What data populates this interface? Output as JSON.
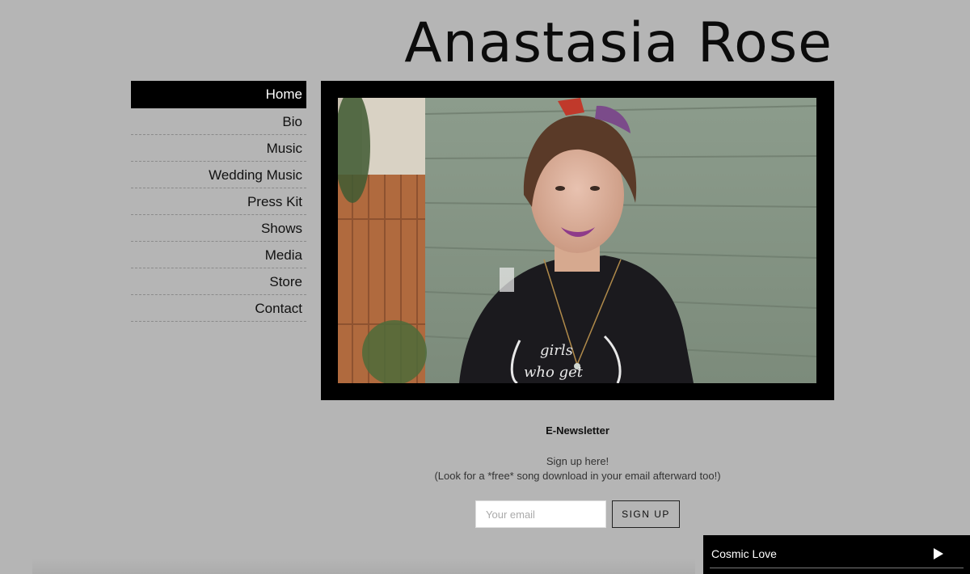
{
  "site": {
    "title": "Anastasia Rose"
  },
  "nav": {
    "items": [
      {
        "label": "Home",
        "active": true
      },
      {
        "label": "Bio"
      },
      {
        "label": "Music"
      },
      {
        "label": "Wedding Music"
      },
      {
        "label": "Press Kit"
      },
      {
        "label": "Shows"
      },
      {
        "label": "Media"
      },
      {
        "label": "Store"
      },
      {
        "label": "Contact"
      }
    ]
  },
  "newsletter": {
    "title": "E-Newsletter",
    "line1": "Sign up here!",
    "line2": "(Look for a *free* song download in your email afterward too!)",
    "email_placeholder": "Your email",
    "button_label": "SIGN UP"
  },
  "player": {
    "track_title": "Cosmic Love",
    "play_icon": "play-icon"
  },
  "colors": {
    "page_background": "#b5b5b5",
    "nav_active_background": "#000000",
    "frame": "#000000",
    "player_background": "#000000"
  }
}
